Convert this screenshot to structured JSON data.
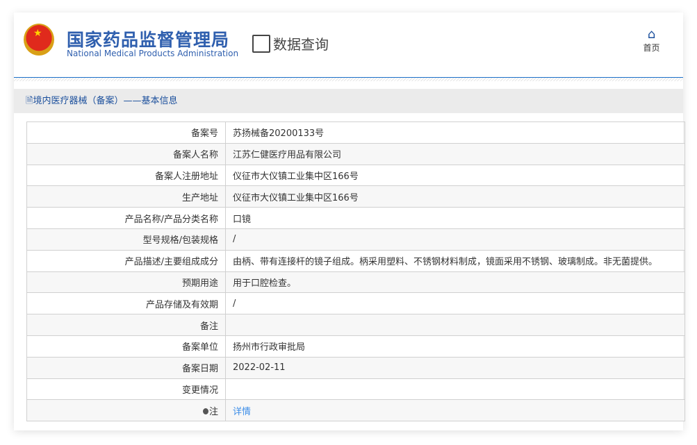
{
  "header": {
    "title_cn": "国家药品监督管理局",
    "title_en": "National Medical Products Administration",
    "query_label": "数据查询",
    "home_label": "首页"
  },
  "section_title": "境内医疗器械（备案）——基本信息",
  "rows": [
    {
      "label": "备案号",
      "value": "苏扬械备20200133号"
    },
    {
      "label": "备案人名称",
      "value": "江苏仁健医疗用品有限公司"
    },
    {
      "label": "备案人注册地址",
      "value": "仪征市大仪镇工业集中区166号"
    },
    {
      "label": "生产地址",
      "value": "仪征市大仪镇工业集中区166号"
    },
    {
      "label": "产品名称/产品分类名称",
      "value": "口镜"
    },
    {
      "label": "型号规格/包装规格",
      "value": "/"
    },
    {
      "label": "产品描述/主要组成成分",
      "value": "由柄、带有连接杆的镜子组成。柄采用塑料、不锈钢材料制成，镜面采用不锈钢、玻璃制成。非无菌提供。"
    },
    {
      "label": "预期用途",
      "value": "用于口腔检查。"
    },
    {
      "label": "产品存储及有效期",
      "value": "/"
    },
    {
      "label": "备注",
      "value": ""
    },
    {
      "label": "备案单位",
      "value": "扬州市行政审批局"
    },
    {
      "label": "备案日期",
      "value": "2022-02-11"
    },
    {
      "label": "变更情况",
      "value": ""
    },
    {
      "label": "注",
      "value": "详情"
    }
  ]
}
